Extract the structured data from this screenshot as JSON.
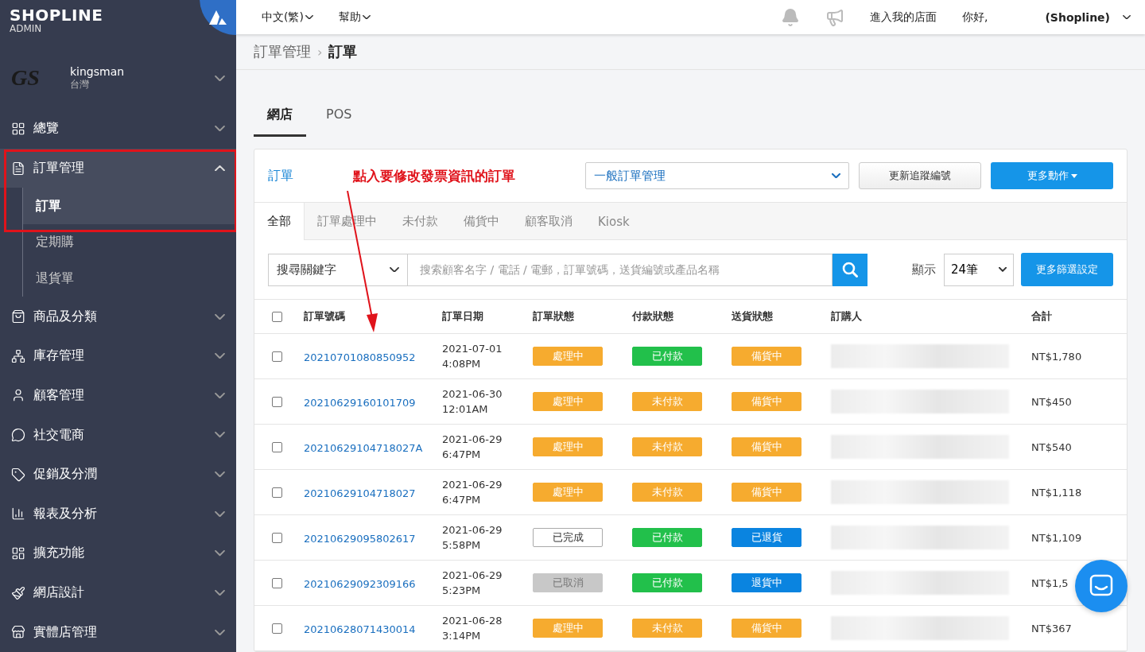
{
  "sidebar": {
    "brand": "SHOPLINE",
    "brand_sub": "ADMIN",
    "store_logo": "GS",
    "store_name": "kingsman",
    "store_region": "台灣",
    "items": [
      {
        "label": "總覽",
        "expanded": false
      },
      {
        "label": "訂單管理",
        "expanded": true,
        "children": [
          {
            "label": "訂單",
            "selected": true
          },
          {
            "label": "定期購",
            "selected": false
          },
          {
            "label": "退貨單",
            "selected": false
          }
        ]
      },
      {
        "label": "商品及分類",
        "expanded": false
      },
      {
        "label": "庫存管理",
        "expanded": false
      },
      {
        "label": "顧客管理",
        "expanded": false
      },
      {
        "label": "社交電商",
        "expanded": false
      },
      {
        "label": "促銷及分潤",
        "expanded": false
      },
      {
        "label": "報表及分析",
        "expanded": false
      },
      {
        "label": "擴充功能",
        "expanded": false
      },
      {
        "label": "網店設計",
        "expanded": false
      },
      {
        "label": "實體店管理",
        "expanded": false
      }
    ]
  },
  "topbar": {
    "language": "中文(繁)",
    "help": "幫助",
    "visit_store": "進入我的店面",
    "greeting": "你好,",
    "user": "(Shopline)"
  },
  "breadcrumb": {
    "items": [
      "訂單管理",
      "訂單"
    ],
    "separator": "›"
  },
  "channel_tabs": [
    {
      "label": "網店",
      "selected": true
    },
    {
      "label": "POS",
      "selected": false
    }
  ],
  "card": {
    "title": "訂單",
    "annotation": "點入要修改發票資訊的訂單",
    "view_select": "一般訂單管理",
    "update_button": "更新追蹤編號",
    "more_actions": "更多動作",
    "status_tabs": [
      {
        "label": "全部",
        "selected": true
      },
      {
        "label": "訂單處理中",
        "selected": false
      },
      {
        "label": "未付款",
        "selected": false
      },
      {
        "label": "備貨中",
        "selected": false
      },
      {
        "label": "顧客取消",
        "selected": false
      },
      {
        "label": "Kiosk",
        "selected": false
      }
    ],
    "search_scope": "搜尋關鍵字",
    "search_placeholder": "搜索顧客名字 / 電話 / 電郵，訂單號碼，送貨編號或產品名稱",
    "show_label": "顯示",
    "page_size": "24筆",
    "filter_button": "更多篩選設定",
    "select_all_checked": false,
    "columns": [
      "訂單號碼",
      "訂單日期",
      "訂單狀態",
      "付款狀態",
      "送貨狀態",
      "訂購人",
      "合計"
    ],
    "rows": [
      {
        "checked": false,
        "order": "20210701080850952",
        "date": "2021-07-01",
        "time": "4:08PM",
        "status": {
          "text": "處理中",
          "kind": "orange"
        },
        "payment": {
          "text": "已付款",
          "kind": "green"
        },
        "delivery": {
          "text": "備貨中",
          "kind": "orange"
        },
        "total": "NT$1,780"
      },
      {
        "checked": false,
        "order": "20210629160101709",
        "date": "2021-06-30",
        "time": "12:01AM",
        "status": {
          "text": "處理中",
          "kind": "orange"
        },
        "payment": {
          "text": "未付款",
          "kind": "orange"
        },
        "delivery": {
          "text": "備貨中",
          "kind": "orange"
        },
        "total": "NT$450"
      },
      {
        "checked": false,
        "order": "20210629104718027A",
        "date": "2021-06-29",
        "time": "6:47PM",
        "status": {
          "text": "處理中",
          "kind": "orange"
        },
        "payment": {
          "text": "未付款",
          "kind": "orange"
        },
        "delivery": {
          "text": "備貨中",
          "kind": "orange"
        },
        "total": "NT$540"
      },
      {
        "checked": false,
        "order": "20210629104718027",
        "date": "2021-06-29",
        "time": "6:47PM",
        "status": {
          "text": "處理中",
          "kind": "orange"
        },
        "payment": {
          "text": "未付款",
          "kind": "orange"
        },
        "delivery": {
          "text": "備貨中",
          "kind": "orange"
        },
        "total": "NT$1,118"
      },
      {
        "checked": false,
        "order": "20210629095802617",
        "date": "2021-06-29",
        "time": "5:58PM",
        "status": {
          "text": "已完成",
          "kind": "outline"
        },
        "payment": {
          "text": "已付款",
          "kind": "green"
        },
        "delivery": {
          "text": "已退貨",
          "kind": "blue"
        },
        "total": "NT$1,109"
      },
      {
        "checked": false,
        "order": "20210629092309166",
        "date": "2021-06-29",
        "time": "5:23PM",
        "status": {
          "text": "已取消",
          "kind": "grey"
        },
        "payment": {
          "text": "已付款",
          "kind": "green"
        },
        "delivery": {
          "text": "退貨中",
          "kind": "blue"
        },
        "total": "NT$1,5"
      },
      {
        "checked": false,
        "order": "20210628071430014",
        "date": "2021-06-28",
        "time": "3:14PM",
        "status": {
          "text": "處理中",
          "kind": "orange"
        },
        "payment": {
          "text": "未付款",
          "kind": "orange"
        },
        "delivery": {
          "text": "備貨中",
          "kind": "orange"
        },
        "total": "NT$367"
      }
    ]
  }
}
